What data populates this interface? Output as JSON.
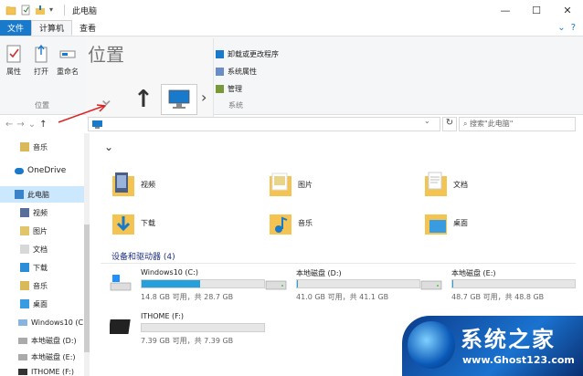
{
  "window": {
    "title": "此电脑",
    "controls": [
      "—",
      "☐",
      "✕"
    ]
  },
  "ribbon": {
    "tabs": [
      "文件",
      "计算机",
      "查看"
    ],
    "buttons": {
      "properties": "属性",
      "open": "打开",
      "rename": "重命名"
    },
    "group_location": "位置",
    "system_items": [
      "卸载或更改程序",
      "系统属性",
      "管理"
    ],
    "group_system": "系统"
  },
  "zoom_overlay": {
    "title": "位置"
  },
  "address": {
    "search_placeholder": "搜索\"此电脑\""
  },
  "nav": {
    "items": [
      {
        "label": "音乐",
        "icon": "music-icon"
      },
      {
        "label": "OneDrive",
        "icon": "cloud-icon"
      },
      {
        "label": "此电脑",
        "icon": "computer-icon",
        "selected": true
      },
      {
        "label": "视频",
        "icon": "video-icon"
      },
      {
        "label": "图片",
        "icon": "picture-icon"
      },
      {
        "label": "文档",
        "icon": "document-icon"
      },
      {
        "label": "下载",
        "icon": "download-icon"
      },
      {
        "label": "音乐",
        "icon": "music-icon"
      },
      {
        "label": "桌面",
        "icon": "desktop-icon"
      },
      {
        "label": "Windows10 (C:)",
        "icon": "drive-icon"
      },
      {
        "label": "本地磁盘 (D:)",
        "icon": "drive-icon"
      },
      {
        "label": "本地磁盘 (E:)",
        "icon": "drive-icon"
      },
      {
        "label": "ITHOME (F:)",
        "icon": "drive-icon"
      }
    ]
  },
  "folders": [
    {
      "name": "视频",
      "icon": "video-folder-icon"
    },
    {
      "name": "图片",
      "icon": "picture-folder-icon"
    },
    {
      "name": "文档",
      "icon": "document-folder-icon"
    },
    {
      "name": "下载",
      "icon": "download-folder-icon"
    },
    {
      "name": "音乐",
      "icon": "music-folder-icon"
    },
    {
      "name": "桌面",
      "icon": "desktop-folder-icon"
    }
  ],
  "devices": {
    "title": "设备和驱动器 (4)",
    "drives": [
      {
        "name": "Windows10 (C:)",
        "size": "14.8 GB 可用，共 28.7 GB",
        "used_fraction": 0.48
      },
      {
        "name": "本地磁盘 (D:)",
        "size": "41.0 GB 可用，共 41.1 GB",
        "used_fraction": 0.01
      },
      {
        "name": "本地磁盘 (E:)",
        "size": "48.7 GB 可用，共 48.8 GB",
        "used_fraction": 0.01
      },
      {
        "name": "ITHOME (F:)",
        "size": "7.39 GB 可用，共 7.39 GB",
        "used_fraction": 0.0
      }
    ]
  },
  "watermark": {
    "cn": "系统之家",
    "url": "www.Ghost123.com"
  },
  "colors": {
    "accent": "#1979ca",
    "selection": "#cce8ff",
    "bar_fill": "#26a0da",
    "folder": "#f3c452"
  }
}
